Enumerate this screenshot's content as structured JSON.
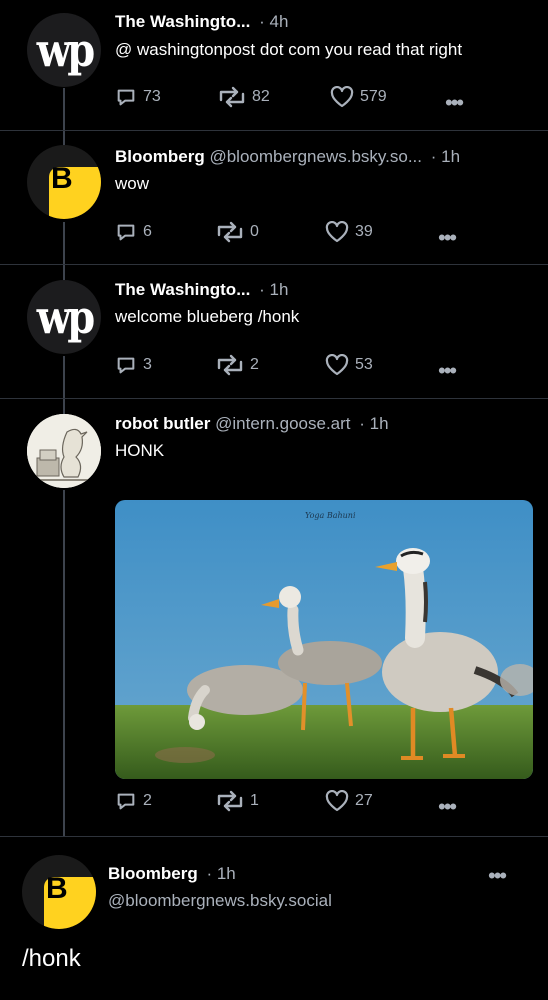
{
  "posts": [
    {
      "name": "The Washingto...",
      "handle": "",
      "time": "· 4h",
      "text": "@ washingtonpost dot com you read that right",
      "replies": "73",
      "reposts": "82",
      "likes": "579",
      "avatar": "wp"
    },
    {
      "name": "Bloomberg",
      "handle": "@bloombergnews.bsky.so...",
      "time": "· 1h",
      "text": "wow",
      "replies": "6",
      "reposts": "0",
      "likes": "39",
      "avatar": "B"
    },
    {
      "name": "The Washingto...",
      "handle": "",
      "time": "· 1h",
      "text": "welcome blueberg /honk",
      "replies": "3",
      "reposts": "2",
      "likes": "53",
      "avatar": "wp"
    },
    {
      "name": "robot butler",
      "handle": "@intern.goose.art",
      "time": "· 1h",
      "text": "HONK",
      "replies": "2",
      "reposts": "1",
      "likes": "27",
      "image_watermark": "Yoga Bahuni"
    }
  ],
  "focused_post": {
    "name": "Bloomberg",
    "time": "· 1h",
    "handle": "@bloombergnews.bsky.social",
    "text": "/honk",
    "avatar": "B"
  },
  "icons": {
    "reply": "reply-bubble-icon",
    "repost": "repost-arrows-icon",
    "like": "heart-icon",
    "more": "more-dots-icon"
  },
  "colors": {
    "background": "#000000",
    "secondary_text": "#aab1bb",
    "bloomberg_yellow": "#ffd21f",
    "divider": "#2e333b"
  }
}
